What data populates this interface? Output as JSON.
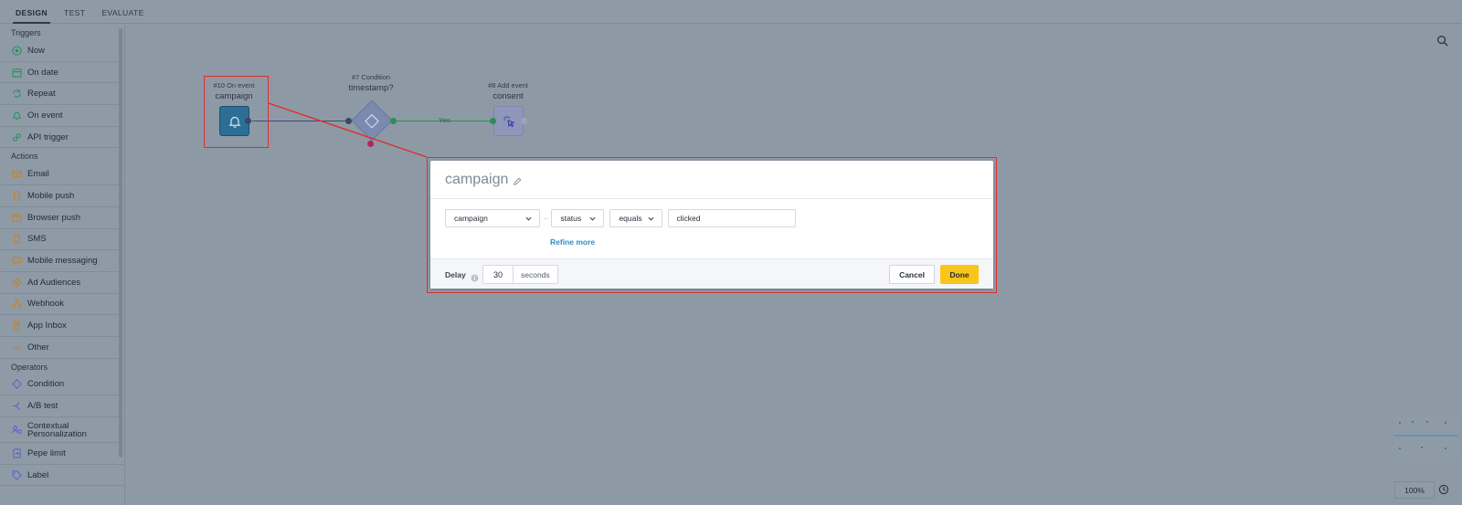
{
  "tabs": [
    "DESIGN",
    "TEST",
    "EVALUATE"
  ],
  "sidebar": {
    "triggers_title": "Triggers",
    "triggers": [
      "Now",
      "On date",
      "Repeat",
      "On event",
      "API trigger"
    ],
    "actions_title": "Actions",
    "actions": [
      "Email",
      "Mobile push",
      "Browser push",
      "SMS",
      "Mobile messaging",
      "Ad Audiences",
      "Webhook",
      "App Inbox",
      "Other"
    ],
    "operators_title": "Operators",
    "operators": [
      "Condition",
      "A/B test",
      "Contextual Personalization",
      "Pepe limit",
      "Label"
    ]
  },
  "canvas": {
    "nodes": [
      {
        "id_label": "#10 On event",
        "name": "campaign"
      },
      {
        "id_label": "#7 Condition",
        "name": "timestamp?"
      },
      {
        "id_label": "#8 Add event",
        "name": "consent"
      }
    ],
    "edge_yes": "Yes",
    "zoom": "100%"
  },
  "modal": {
    "title": "campaign",
    "field1": "campaign",
    "field2": "status",
    "operator": "equals",
    "value": "clicked",
    "refine": "Refine more",
    "delay_label": "Delay",
    "delay_value": "30",
    "delay_unit": "seconds",
    "cancel": "Cancel",
    "done": "Done"
  },
  "colors": {
    "accent": "#2e8ec7",
    "done_button": "#f8c51b",
    "annotation": "#e42b2b"
  }
}
